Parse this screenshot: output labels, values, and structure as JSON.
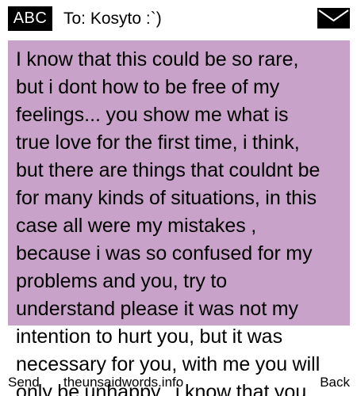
{
  "header": {
    "mode_label": "ABC",
    "recipient": "To: Kosyto :`)",
    "envelope_icon": "envelope-icon"
  },
  "message": {
    "lines": [
      "I know that this could be so rare,",
      "but i dont how to be free of my",
      "feelings... you show me what is",
      "true love for the first time, i think,",
      "but there are things that couldnt be",
      "for many kinds of situations, in this",
      "case all were my mistakes ,",
      "because i was so confused for my",
      "problems and you, try to",
      "understand please it was not my",
      "intention to hurt you, but it was",
      "necessary for you, with me you will",
      "only be unhappy.. i know that you"
    ]
  },
  "softkeys": {
    "left": "Send",
    "center": "theunsaidwords.info",
    "right": "Back"
  },
  "colors": {
    "highlight": "#c8a2c8",
    "badge_bg": "#000000",
    "badge_text": "#ffffff"
  }
}
